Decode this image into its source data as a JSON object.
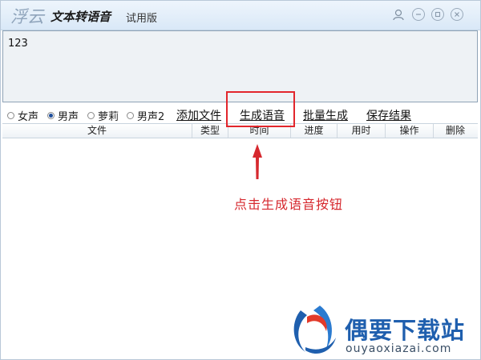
{
  "titlebar": {
    "brand": "浮云",
    "title": "文本转语音",
    "edition": "试用版"
  },
  "text_input": {
    "value": "123"
  },
  "voices": [
    {
      "label": "女声",
      "selected": false
    },
    {
      "label": "男声",
      "selected": true
    },
    {
      "label": "萝莉",
      "selected": false
    },
    {
      "label": "男声2",
      "selected": false
    }
  ],
  "actions": {
    "add_file": "添加文件",
    "generate": "生成语音",
    "batch": "批量生成",
    "save": "保存结果"
  },
  "table": {
    "columns": [
      "文件",
      "类型",
      "时间",
      "进度",
      "用时",
      "操作",
      "删除"
    ]
  },
  "annotation": {
    "text": "点击生成语音按钮",
    "color": "#e2262c"
  },
  "watermark": {
    "title": "偶要下载站",
    "url": "ouyaoxiazai.com",
    "color": "#1f5fae"
  },
  "icons": {
    "user": "user-icon",
    "minimize": "minimize-icon",
    "restore": "restore-icon",
    "close": "close-icon"
  }
}
